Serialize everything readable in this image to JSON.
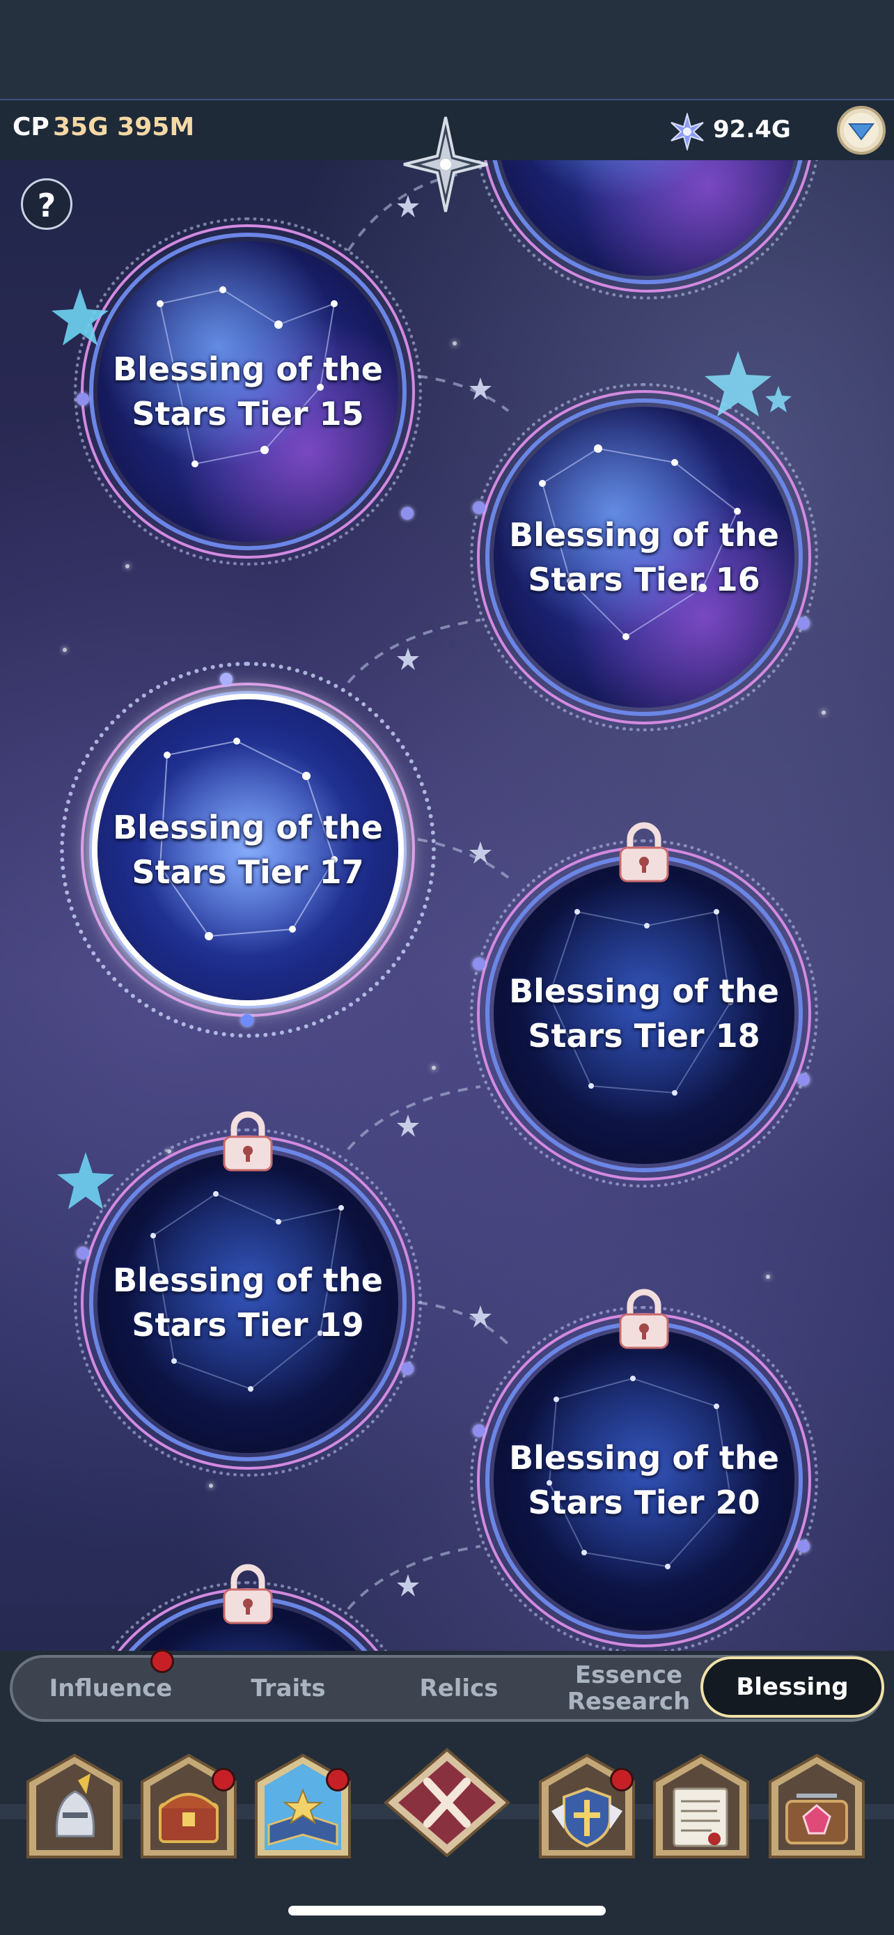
{
  "header": {
    "cp_label": "CP",
    "cp_value": "35G 395M",
    "gem_value": "92.4G",
    "gem_icon": "star-crystal-icon",
    "dropdown_icon": "chevron-down-icon"
  },
  "help": {
    "label": "?"
  },
  "tiers": [
    {
      "line1": "Blessing of the",
      "line2": "Stars Tier 15",
      "locked": false
    },
    {
      "line1": "Blessing of the",
      "line2": "Stars Tier 16",
      "locked": false
    },
    {
      "line1": "Blessing of the",
      "line2": "Stars Tier 17",
      "locked": false,
      "selected": true
    },
    {
      "line1": "Blessing of the",
      "line2": "Stars Tier 18",
      "locked": true
    },
    {
      "line1": "Blessing of the",
      "line2": "Stars Tier 19",
      "locked": true
    },
    {
      "line1": "Blessing of the",
      "line2": "Stars Tier 20",
      "locked": true
    }
  ],
  "tabs": [
    {
      "label": "Influence",
      "badge": true
    },
    {
      "label": "Traits",
      "badge": false
    },
    {
      "label": "Relics",
      "badge": false
    },
    {
      "label_line1": "Essence",
      "label_line2": "Research",
      "badge": false
    },
    {
      "label": "Blessing",
      "active": true
    }
  ],
  "bottom_nav": [
    {
      "icon": "knight-helmet-icon",
      "badge": false
    },
    {
      "icon": "treasure-chest-icon",
      "badge": true
    },
    {
      "icon": "star-book-icon",
      "badge": true,
      "active": true
    },
    {
      "icon": "close-x-icon",
      "badge": false
    },
    {
      "icon": "guild-shield-icon",
      "badge": true
    },
    {
      "icon": "scroll-quest-icon",
      "badge": false
    },
    {
      "icon": "gem-box-icon",
      "badge": false
    }
  ],
  "colors": {
    "cp_value": "#f4d9a6",
    "tab_active_border": "#f0e2a8",
    "badge_red": "#c62026",
    "ring_purple": "#d28ae0",
    "ring_blue": "#6b86e6"
  }
}
